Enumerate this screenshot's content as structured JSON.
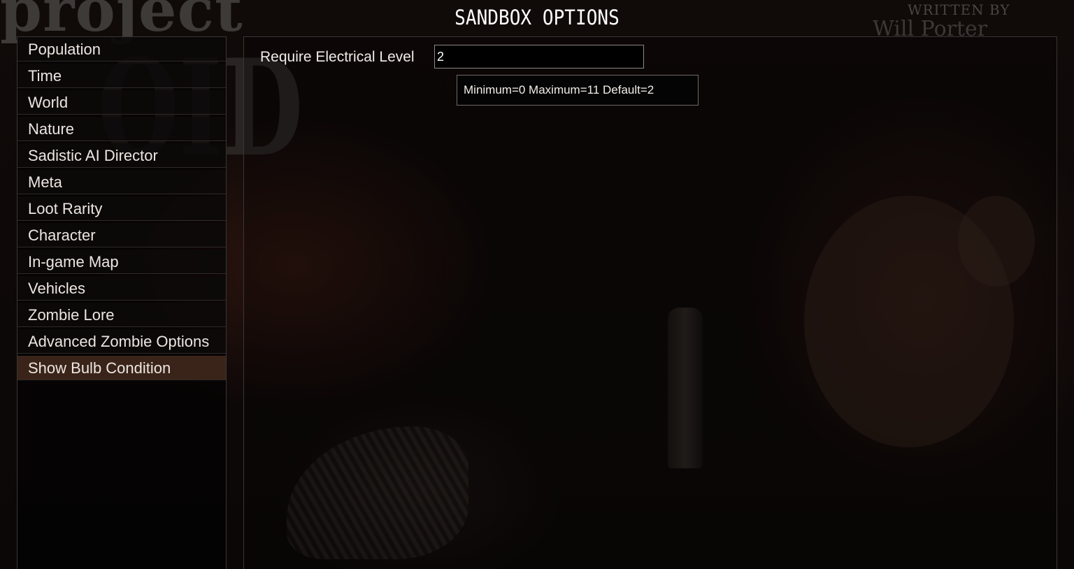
{
  "background": {
    "logo_text_1": "project",
    "logo_text_2": "OID",
    "credit_heading": "WRITTEN BY",
    "credit_name": "Will Porter"
  },
  "title": "SANDBOX OPTIONS",
  "sidebar": {
    "items": [
      {
        "label": "Population"
      },
      {
        "label": "Time"
      },
      {
        "label": "World"
      },
      {
        "label": "Nature"
      },
      {
        "label": "Sadistic AI Director"
      },
      {
        "label": "Meta"
      },
      {
        "label": "Loot Rarity"
      },
      {
        "label": "Character"
      },
      {
        "label": "In-game Map"
      },
      {
        "label": "Vehicles"
      },
      {
        "label": "Zombie Lore"
      },
      {
        "label": "Advanced Zombie Options"
      },
      {
        "label": "Show Bulb Condition"
      }
    ],
    "selected_index": 12
  },
  "main": {
    "option": {
      "label": "Require Electrical Level",
      "value": "2"
    },
    "tooltip": "Minimum=0 Maximum=11 Default=2"
  },
  "colors": {
    "selected_item_bg": "#3a2419",
    "text": "#ece6e0"
  }
}
